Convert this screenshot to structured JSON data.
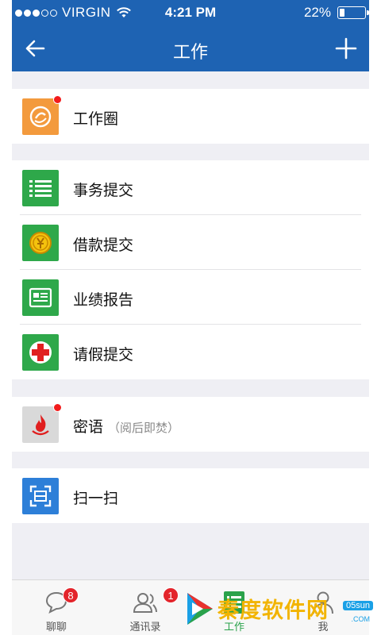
{
  "status_bar": {
    "carrier": "VIRGIN",
    "time": "4:21 PM",
    "battery_text": "22%",
    "battery_level": 0.22,
    "signal_dots_filled": 3,
    "signal_dots_total": 5
  },
  "navbar": {
    "title": "工作",
    "back_icon": "arrow-left-icon",
    "add_icon": "plus-icon"
  },
  "groups": [
    {
      "items": [
        {
          "label": "工作圈",
          "icon": "work-circle-icon",
          "color": "#f39a3d",
          "has_dot": true
        }
      ]
    },
    {
      "items": [
        {
          "label": "事务提交",
          "icon": "list-icon",
          "color": "#2ea84a",
          "has_dot": false
        },
        {
          "label": "借款提交",
          "icon": "coin-icon",
          "color": "#2ea84a",
          "has_dot": false
        },
        {
          "label": "业绩报告",
          "icon": "report-icon",
          "color": "#2ea84a",
          "has_dot": false
        },
        {
          "label": "请假提交",
          "icon": "medical-cross-icon",
          "color": "#2ea84a",
          "has_dot": false
        }
      ]
    },
    {
      "items": [
        {
          "label": "密语",
          "sublabel": "（阅后即焚）",
          "icon": "flame-icon",
          "color": "#d9d9d9",
          "has_dot": true
        }
      ]
    },
    {
      "items": [
        {
          "label": "扫一扫",
          "icon": "scan-icon",
          "color": "#2d7fd8",
          "has_dot": false
        }
      ]
    }
  ],
  "tabbar": {
    "tabs": [
      {
        "label": "聊聊",
        "icon": "chat-bubble-icon",
        "count": "8"
      },
      {
        "label": "通讯录",
        "icon": "contacts-icon",
        "count": "1"
      },
      {
        "label": "工作",
        "icon": "work-list-icon",
        "active": true
      },
      {
        "label": "我",
        "icon": "person-icon"
      }
    ]
  },
  "watermark": {
    "text": "秦度软件网",
    "site": "05sun",
    "domain": ".COM"
  },
  "colors": {
    "header_bg": "#1e63b3",
    "page_bg": "#efeff4",
    "badge_red": "#f21c1c",
    "active_tab": "#2aa24b"
  }
}
